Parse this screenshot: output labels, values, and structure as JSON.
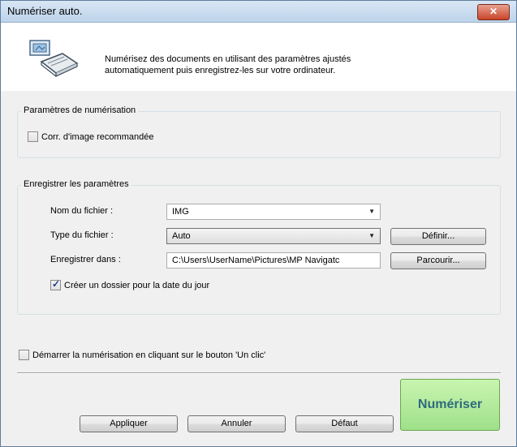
{
  "window": {
    "title": "Numériser auto.",
    "close_label": "✕"
  },
  "header": {
    "line1": "Numérisez des documents en utilisant des paramètres ajustés",
    "line2": "automatiquement puis enregistrez-les sur votre ordinateur."
  },
  "scan_settings": {
    "group_label": "Paramètres de numérisation",
    "image_correction_label": "Corr. d'image recommandée",
    "image_correction_checked": false
  },
  "save_settings": {
    "group_label": "Enregistrer les paramètres",
    "file_name_label": "Nom du fichier :",
    "file_name_value": "IMG",
    "file_type_label": "Type du fichier :",
    "file_type_value": "Auto",
    "define_button": "Définir...",
    "save_in_label": "Enregistrer dans :",
    "save_in_value": "C:\\Users\\UserName\\Pictures\\MP Navigatc",
    "browse_button": "Parcourir...",
    "date_folder_label": "Créer un dossier pour la date du jour",
    "date_folder_checked": true
  },
  "one_click_label": "Démarrer la numérisation en cliquant sur le bouton 'Un clic'",
  "one_click_checked": false,
  "buttons": {
    "apply": "Appliquer",
    "cancel": "Annuler",
    "default": "Défaut",
    "scan": "Numériser"
  }
}
